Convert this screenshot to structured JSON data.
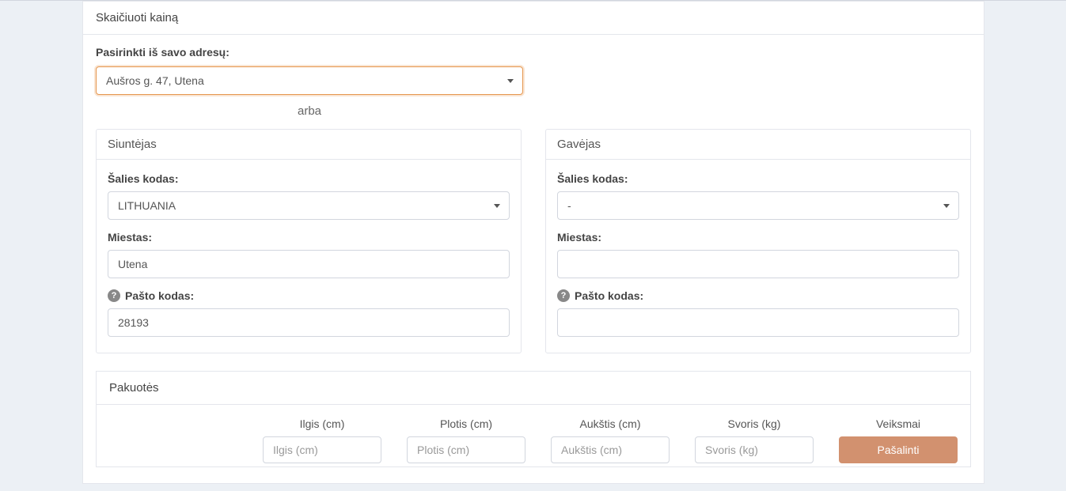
{
  "header": {
    "title": "Skaičiuoti kainą"
  },
  "address_picker": {
    "label": "Pasirinkti iš savo adresų:",
    "selected": "Aušros g. 47, Utena",
    "or_text": "arba"
  },
  "sender": {
    "title": "Siuntėjas",
    "country_label": "Šalies kodas:",
    "country_value": "LITHUANIA",
    "city_label": "Miestas:",
    "city_value": "Utena",
    "postcode_label": "Pašto kodas:",
    "postcode_value": "28193"
  },
  "receiver": {
    "title": "Gavėjas",
    "country_label": "Šalies kodas:",
    "country_value": "-",
    "city_label": "Miestas:",
    "city_value": "",
    "postcode_label": "Pašto kodas:",
    "postcode_value": ""
  },
  "packages": {
    "title": "Pakuotės",
    "cols": {
      "length_label": "Ilgis (cm)",
      "length_ph": "Ilgis (cm)",
      "width_label": "Plotis (cm)",
      "width_ph": "Plotis (cm)",
      "height_label": "Aukštis (cm)",
      "height_ph": "Aukštis (cm)",
      "weight_label": "Svoris (kg)",
      "weight_ph": "Svoris (kg)",
      "actions_label": "Veiksmai",
      "remove_label": "Pašalinti"
    }
  }
}
